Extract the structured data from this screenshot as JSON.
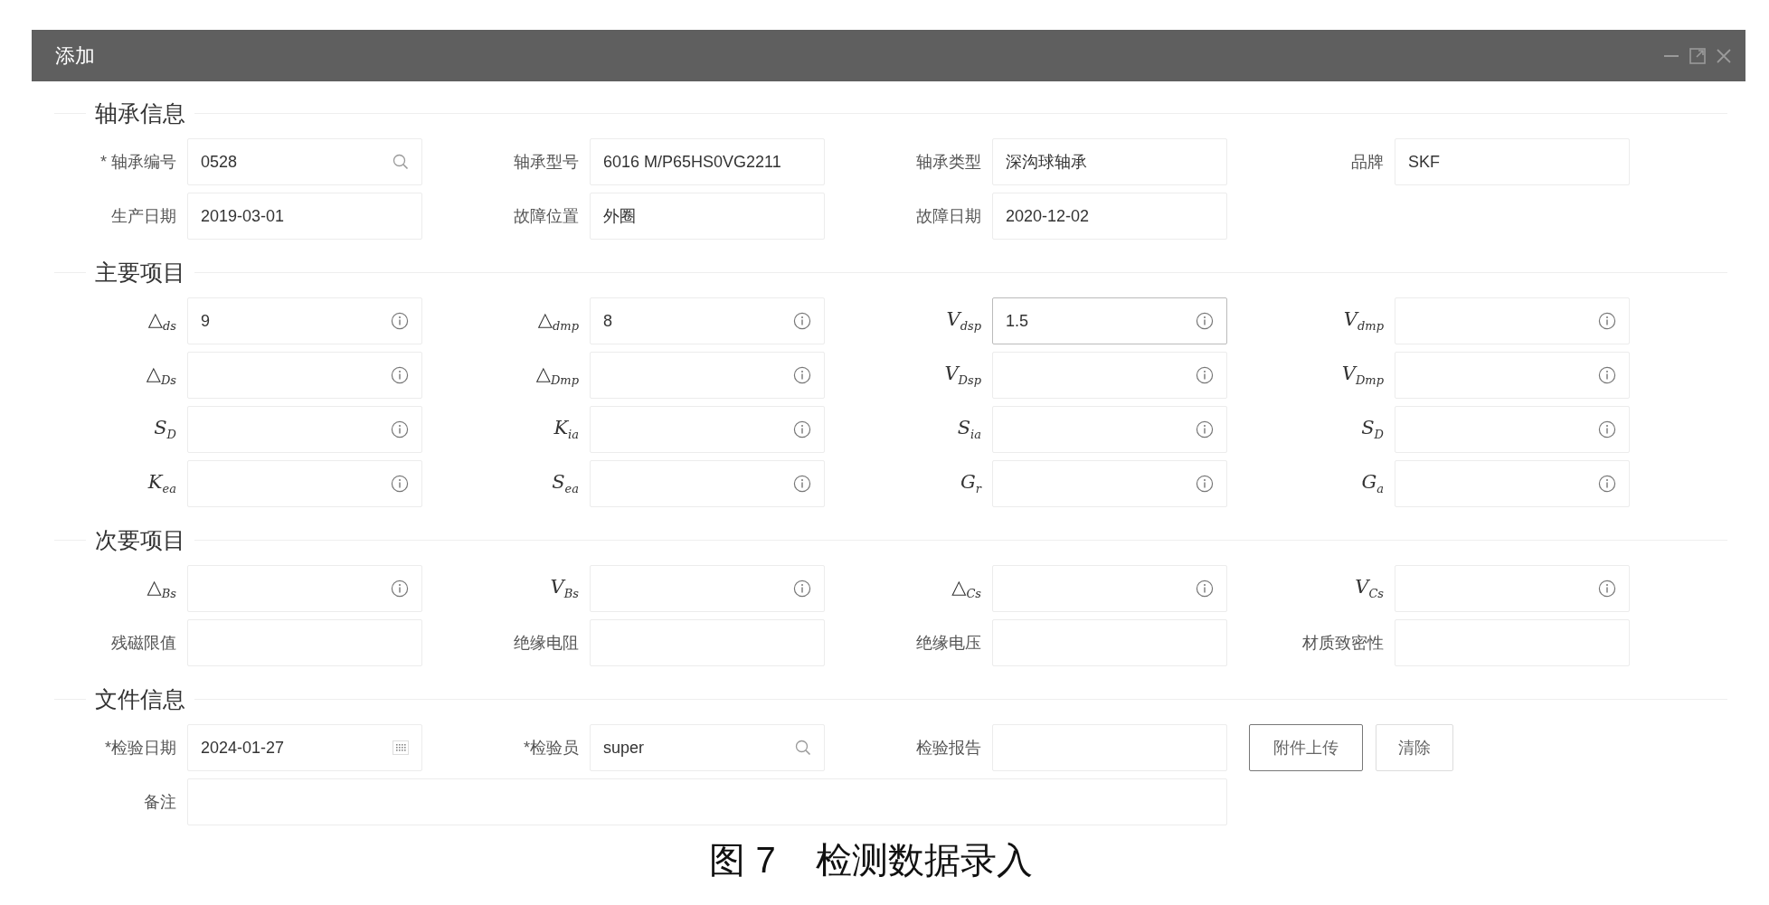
{
  "window": {
    "title": "添加"
  },
  "sections": [
    {
      "title": "轴承信息",
      "rows": [
        {
          "cells": [
            {
              "kind": "search_field",
              "label": "* 轴承编号",
              "value": "0528",
              "focused": false
            },
            {
              "kind": "field",
              "label": "轴承型号",
              "value": "6016 M/P65HS0VG2211",
              "focused": false
            },
            {
              "kind": "field",
              "label": "轴承类型",
              "value": "深沟球轴承",
              "focused": false
            },
            {
              "kind": "field",
              "label": "品牌",
              "value": "SKF",
              "focused": false
            }
          ]
        },
        {
          "cells": [
            {
              "kind": "field",
              "label": "生产日期",
              "value": "2019-03-01",
              "focused": false
            },
            {
              "kind": "field",
              "label": "故障位置",
              "value": "外圈",
              "focused": false
            },
            {
              "kind": "field",
              "label": "故障日期",
              "value": "2020-12-02",
              "focused": false
            }
          ]
        }
      ]
    },
    {
      "title": "主要项目",
      "rows": [
        {
          "cells": [
            {
              "kind": "measure",
              "label": "△$_{ds}$",
              "value": "9",
              "focused": false
            },
            {
              "kind": "measure",
              "label": "△$_{dmp}$",
              "value": "8",
              "focused": false
            },
            {
              "kind": "measure",
              "label": "V$_{dsp}$",
              "value": "1.5",
              "focused": true
            },
            {
              "kind": "measure",
              "label": "V$_{dmp}$",
              "focused": false
            }
          ]
        },
        {
          "cells": [
            {
              "kind": "measure",
              "label": "△$_{Ds}$",
              "focused": false
            },
            {
              "kind": "measure",
              "label": "△$_{Dmp}$",
              "focused": false
            },
            {
              "kind": "measure",
              "label": "V$_{Dsp}$",
              "focused": false
            },
            {
              "kind": "measure",
              "label": "V$_{Dmp}$",
              "focused": false
            }
          ]
        },
        {
          "cells": [
            {
              "kind": "measure",
              "label": "S$_{D}$",
              "focused": false
            },
            {
              "kind": "measure",
              "label": "K$_{ia}$",
              "focused": false
            },
            {
              "kind": "measure",
              "label": "S$_{ia}$",
              "focused": false
            },
            {
              "kind": "measure",
              "label": "S$_{D}$",
              "focused": false
            }
          ]
        },
        {
          "cells": [
            {
              "kind": "measure",
              "label": "K$_{ea}$",
              "focused": false
            },
            {
              "kind": "measure",
              "label": "S$_{ea}$",
              "focused": false
            },
            {
              "kind": "measure",
              "label": "G$_{r}$",
              "focused": false
            },
            {
              "kind": "measure",
              "label": "G$_{a}$",
              "focused": false
            }
          ]
        }
      ]
    },
    {
      "title": "次要项目",
      "rows": [
        {
          "cells": [
            {
              "kind": "measure",
              "label": "△$_{Bs}$",
              "focused": false
            },
            {
              "kind": "measure",
              "label": "V$_{Bs}$",
              "focused": false
            },
            {
              "kind": "measure",
              "label": "△$_{Cs}$",
              "focused": false
            },
            {
              "kind": "measure",
              "label": "V$_{Cs}$",
              "focused": false
            }
          ]
        },
        {
          "cells": [
            {
              "kind": "field",
              "label": "残磁限值",
              "focused": false
            },
            {
              "kind": "field",
              "label": "绝缘电阻",
              "focused": false
            },
            {
              "kind": "field",
              "label": "绝缘电压",
              "focused": false
            },
            {
              "kind": "field",
              "label": "材质致密性",
              "focused": false
            }
          ]
        }
      ]
    },
    {
      "title": "文件信息",
      "rows": [
        {
          "cells": [
            {
              "kind": "date_field",
              "label": "*检验日期",
              "value": "2024-01-27",
              "focused": false
            },
            {
              "kind": "search_field",
              "label": "*检验员",
              "value": "super",
              "focused": false
            },
            {
              "kind": "field",
              "label": "检验报告",
              "focused": false
            },
            {
              "kind": "buttons",
              "buttons": [
                {
                  "label": "附件上传",
                  "primary": true
                },
                {
                  "label": "清除",
                  "primary": false
                }
              ]
            }
          ]
        },
        {
          "cells": [
            {
              "kind": "wide_field",
              "label": "备注",
              "focused": false
            }
          ]
        }
      ]
    }
  ],
  "caption": {
    "number": "图 7",
    "text": "检测数据录入"
  }
}
